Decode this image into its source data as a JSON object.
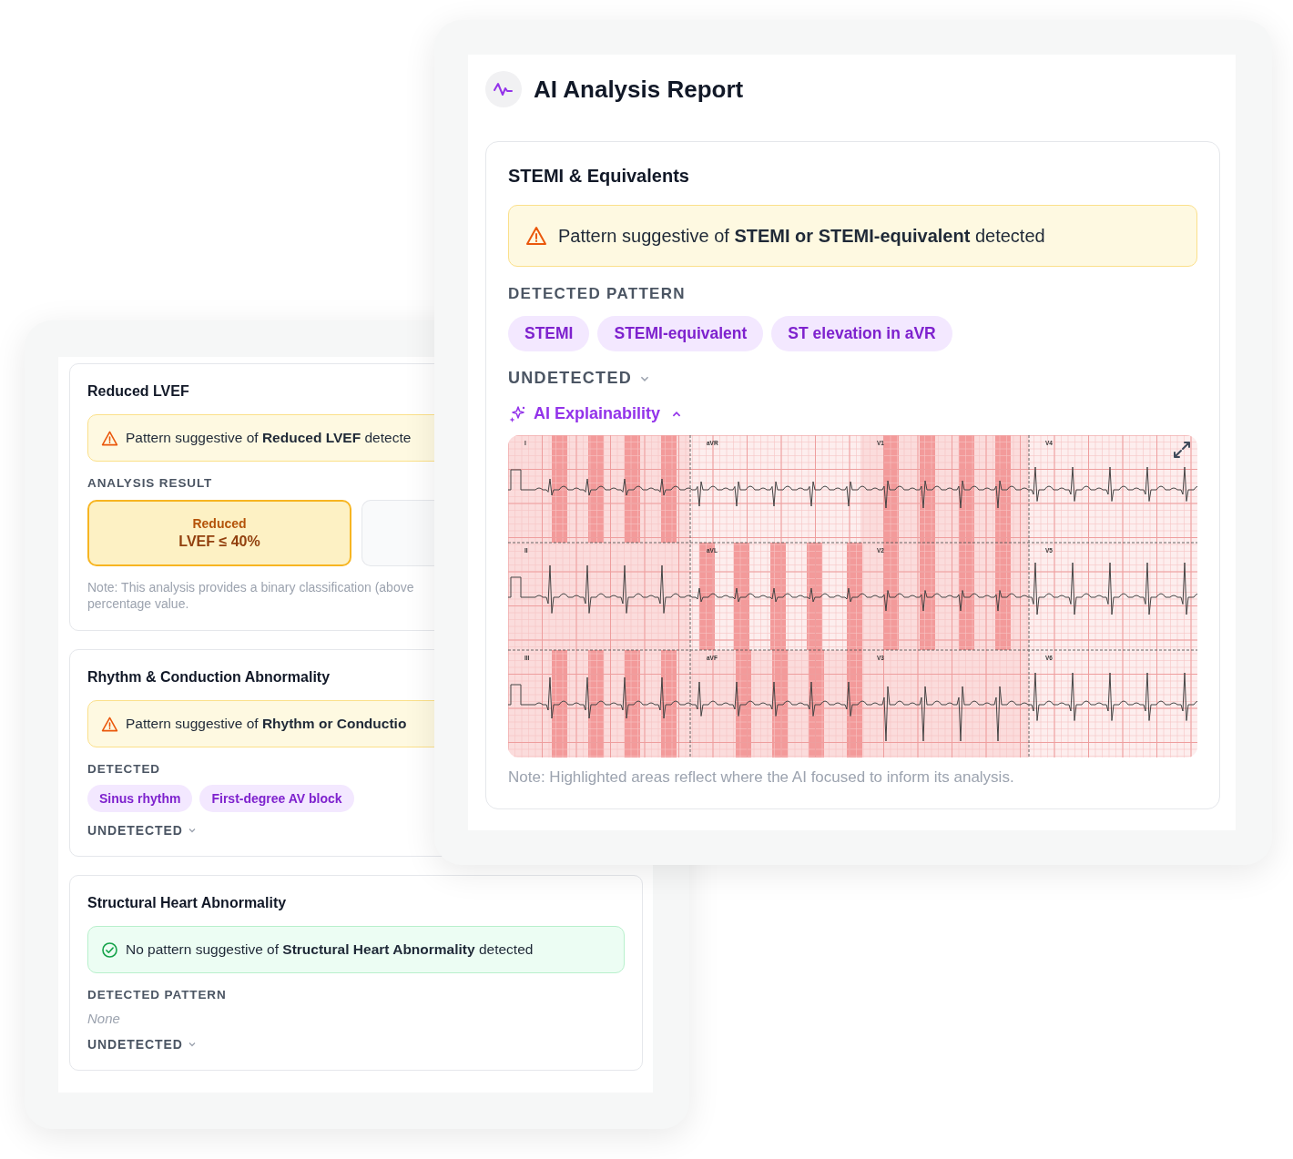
{
  "back_window": {
    "cards": [
      {
        "kind": "result",
        "title": "Reduced LVEF",
        "banner": {
          "kind": "warning",
          "text": "Pattern suggestive of **Reduced LVEF** detecte"
        },
        "section_label": "ANALYSIS RESULT",
        "options": [
          {
            "lines": [
              "Reduced",
              "LVEF ≤ 40%"
            ],
            "selected": true
          },
          {
            "selected": false
          }
        ],
        "note_lines": [
          "Note: This analysis provides a binary classification (above",
          "percentage value."
        ]
      },
      {
        "kind": "patterns",
        "title": "Rhythm & Conduction Abnormality",
        "banner": {
          "kind": "warning",
          "text": "Pattern suggestive of **Rhythm or Conductio**"
        },
        "section_label": "DETECTED",
        "chips": [
          "Sinus rhythm",
          "First-degree AV block"
        ],
        "undetected": {
          "label": "UNDETECTED",
          "expanded": false
        }
      },
      {
        "kind": "patterns",
        "title": "Structural Heart Abnormality",
        "banner": {
          "kind": "ok",
          "text": "No pattern suggestive of **Structural Heart Abnormality** detected"
        },
        "section_label": "DETECTED PATTERN",
        "empty_text": "None",
        "undetected": {
          "label": "UNDETECTED",
          "expanded": false
        }
      }
    ]
  },
  "report": {
    "title": "AI Analysis Report",
    "card": {
      "title": "STEMI & Equivalents",
      "banner": {
        "kind": "warning",
        "text": "Pattern suggestive of **STEMI or STEMI-equivalent** detected"
      },
      "section_label": "DETECTED PATTERN",
      "chips": [
        "STEMI",
        "STEMI-equivalent",
        "ST elevation in aVR"
      ],
      "undetected": {
        "label": "UNDETECTED",
        "expanded": false
      },
      "explainability": {
        "label": "AI Explainability",
        "expanded": true,
        "leads": [
          "I",
          "aVR",
          "V1",
          "V4",
          "II",
          "aVL",
          "V2",
          "V5",
          "III",
          "aVF",
          "V3",
          "V6"
        ],
        "note": "Note: Highlighted areas reflect where the AI focused to inform its analysis."
      }
    }
  }
}
